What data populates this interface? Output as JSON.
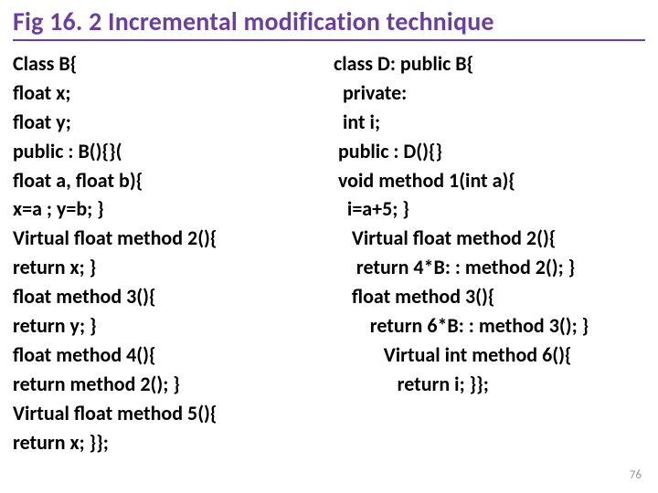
{
  "title": "Fig 16. 2 Incremental modification technique",
  "left_code": "Class B{\nfloat x;\nfloat y;\npublic : B(){}(\nfloat a, float b){\nx=a ; y=b; }\nVirtual float method 2(){\nreturn x; }\nfloat method 3(){\nreturn y; }\nfloat method 4(){\nreturn method 2(); }\nVirtual float method 5(){\nreturn x; }};",
  "right_code": "class D: public B{\n  private:\n  int i;\n public : D(){}\n void method 1(int a){\n   i=a+5; }\n    Virtual float method 2(){\n     return 4*B: : method 2(); }\n    float method 3(){\n        return 6*B: : method 3(); }\n           Virtual int method 6(){\n              return i; }};",
  "page_number": "76"
}
